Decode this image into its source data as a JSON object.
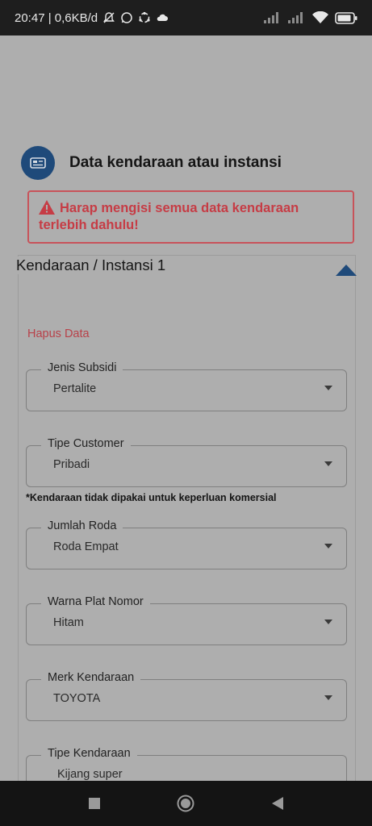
{
  "status_bar": {
    "time_speed": "20:47 | 0,6KB/d",
    "icons": [
      "notification-off-icon",
      "whatsapp-icon",
      "sync-icon",
      "cloud-icon",
      "signal-icon",
      "signal-icon",
      "wifi-icon",
      "battery-icon"
    ]
  },
  "section": {
    "title": "Data kendaraan atau instansi",
    "icon": "id-card-icon",
    "accent_color": "#1f4a7a"
  },
  "alert": {
    "message": "Harap mengisi semua data kendaraan terlebih dahulu!",
    "icon": "warning-icon",
    "color": "#c63c45"
  },
  "vehicle": {
    "title": "Kendaraan / Instansi 1",
    "delete_label": "Hapus Data"
  },
  "fields": [
    {
      "label": "Jenis Subsidi",
      "value": "Pertalite"
    },
    {
      "label": "Tipe Customer",
      "value": "Pribadi"
    },
    {
      "label": "Jumlah Roda",
      "value": "Roda Empat"
    },
    {
      "label": "Warna Plat Nomor",
      "value": "Hitam"
    },
    {
      "label": "Merk Kendaraan",
      "value": "TOYOTA"
    },
    {
      "label": "Tipe Kendaraan",
      "value": "Kijang super"
    }
  ],
  "note": "*Kendaraan tidak dipakai untuk keperluan komersial",
  "nav": {
    "icons": [
      "recent-apps-icon",
      "home-icon",
      "back-icon"
    ]
  }
}
